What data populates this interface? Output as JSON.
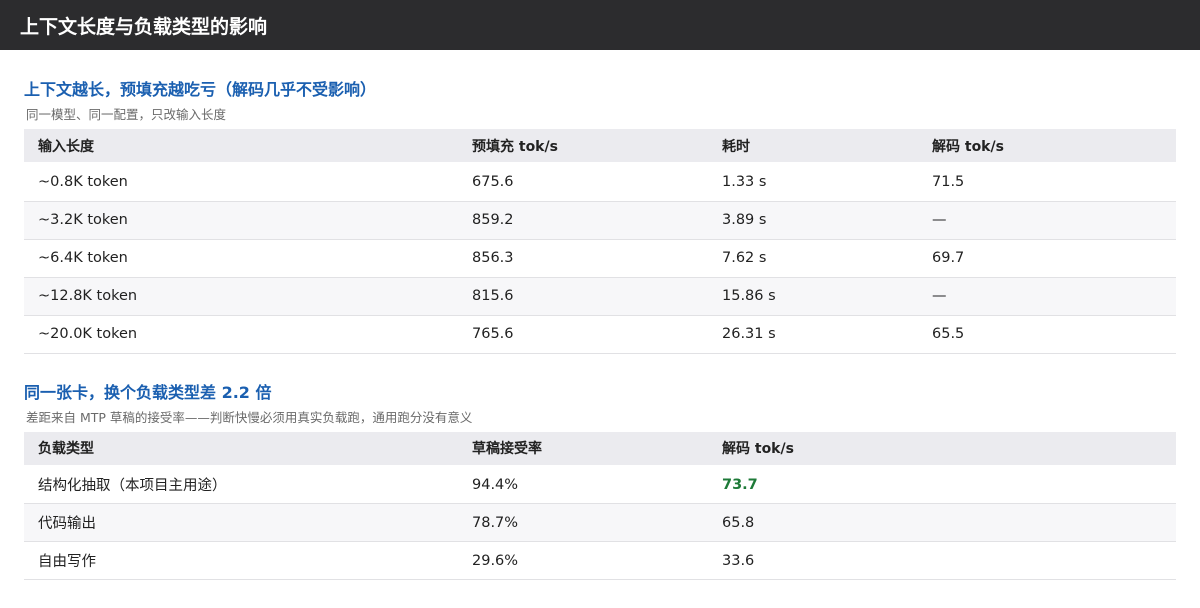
{
  "header": {
    "title": "上下文长度与负载类型的影响"
  },
  "section1": {
    "title": "上下文越长，预填充越吃亏（解码几乎不受影响）",
    "subtitle": "同一模型、同一配置，只改输入长度",
    "columns": [
      "输入长度",
      "预填充 tok/s",
      "耗时",
      "解码 tok/s"
    ],
    "rows": [
      [
        "~0.8K token",
        "675.6",
        "1.33 s",
        "71.5"
      ],
      [
        "~3.2K token",
        "859.2",
        "3.89 s",
        "—"
      ],
      [
        "~6.4K token",
        "856.3",
        "7.62 s",
        "69.7"
      ],
      [
        "~12.8K token",
        "815.6",
        "15.86 s",
        "—"
      ],
      [
        "~20.0K token",
        "765.6",
        "26.31 s",
        "65.5"
      ]
    ]
  },
  "section2": {
    "title": "同一张卡，换个负载类型差 2.2 倍",
    "subtitle": "差距来自 MTP 草稿的接受率——判断快慢必须用真实负载跑，通用跑分没有意义",
    "columns": [
      "负载类型",
      "草稿接受率",
      "解码 tok/s"
    ],
    "rows": [
      [
        "结构化抽取（本项目主用途）",
        "94.4%",
        "73.7"
      ],
      [
        "代码输出",
        "78.7%",
        "65.8"
      ],
      [
        "自由写作",
        "29.6%",
        "33.6"
      ]
    ],
    "highlight_color": "#1e7a38"
  }
}
